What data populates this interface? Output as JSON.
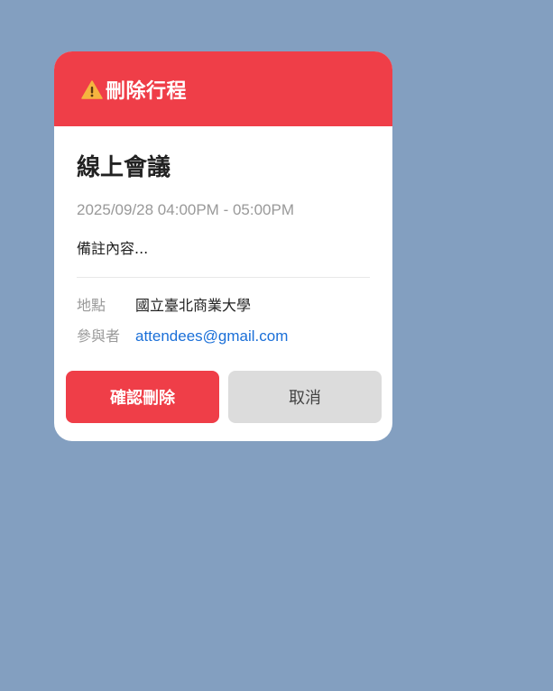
{
  "dialog": {
    "icon": "warning-icon",
    "title": "刪除行程",
    "event": {
      "title": "線上會議",
      "time": "2025/09/28 04:00PM - 05:00PM",
      "note": "備註內容..."
    },
    "details": {
      "location_label": "地點",
      "location_value": "國立臺北商業大學",
      "attendees_label": "參與者",
      "attendees_value": "attendees@gmail.com"
    },
    "buttons": {
      "confirm_label": "確認刪除",
      "cancel_label": "取消"
    }
  },
  "colors": {
    "background": "#839fc0",
    "danger": "#ef3e48",
    "link": "#1a6fd8",
    "secondary_button": "#dcdcdc"
  }
}
